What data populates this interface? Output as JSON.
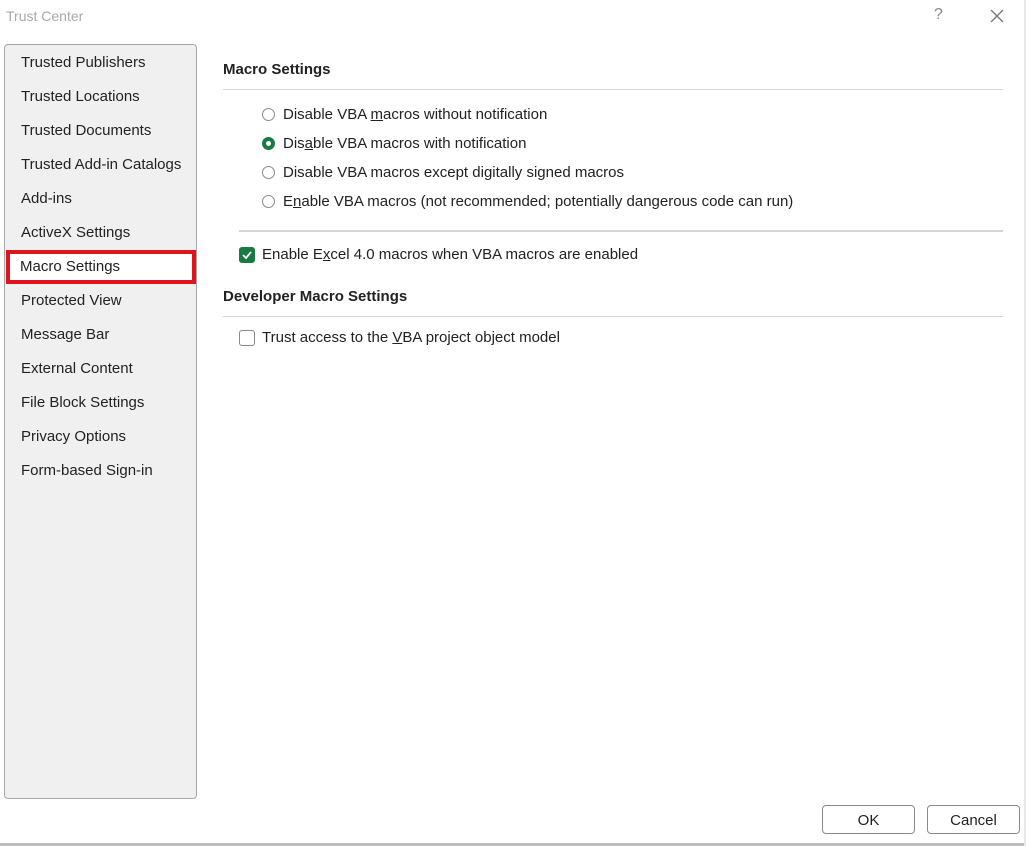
{
  "window": {
    "title": "Trust Center",
    "help_label": "?",
    "close_icon": "close-icon"
  },
  "sidebar": {
    "items": [
      {
        "label": "Trusted Publishers"
      },
      {
        "label": "Trusted Locations"
      },
      {
        "label": "Trusted Documents"
      },
      {
        "label": "Trusted Add-in Catalogs"
      },
      {
        "label": "Add-ins"
      },
      {
        "label": "ActiveX Settings"
      },
      {
        "label": "Macro Settings",
        "selected": true
      },
      {
        "label": "Protected View"
      },
      {
        "label": "Message Bar"
      },
      {
        "label": "External Content"
      },
      {
        "label": "File Block Settings"
      },
      {
        "label": "Privacy Options"
      },
      {
        "label": "Form-based Sign-in"
      }
    ]
  },
  "macro_settings": {
    "heading": "Macro Settings",
    "options": [
      {
        "pre": "Disable VBA ",
        "key": "m",
        "post": "acros without notification",
        "checked": false
      },
      {
        "pre": "Dis",
        "key": "a",
        "post": "ble VBA macros with notification",
        "checked": true
      },
      {
        "pre": "Disable VBA macros except di",
        "key": "g",
        "post": "itally signed macros",
        "checked": false
      },
      {
        "pre": "E",
        "key": "n",
        "post": "able VBA macros (not recommended; potentially dangerous code can run)",
        "checked": false
      }
    ],
    "excel4": {
      "pre": "Enable E",
      "key": "x",
      "post": "cel 4.0 macros when VBA macros are enabled",
      "checked": true
    }
  },
  "developer_settings": {
    "heading": "Developer Macro Settings",
    "trust_vba": {
      "pre": "Trust access to the ",
      "key": "V",
      "post": "BA project object model",
      "checked": false
    }
  },
  "footer": {
    "ok_label": "OK",
    "cancel_label": "Cancel"
  },
  "colors": {
    "accent": "#1b7a43",
    "highlight_box": "#e0141e"
  }
}
